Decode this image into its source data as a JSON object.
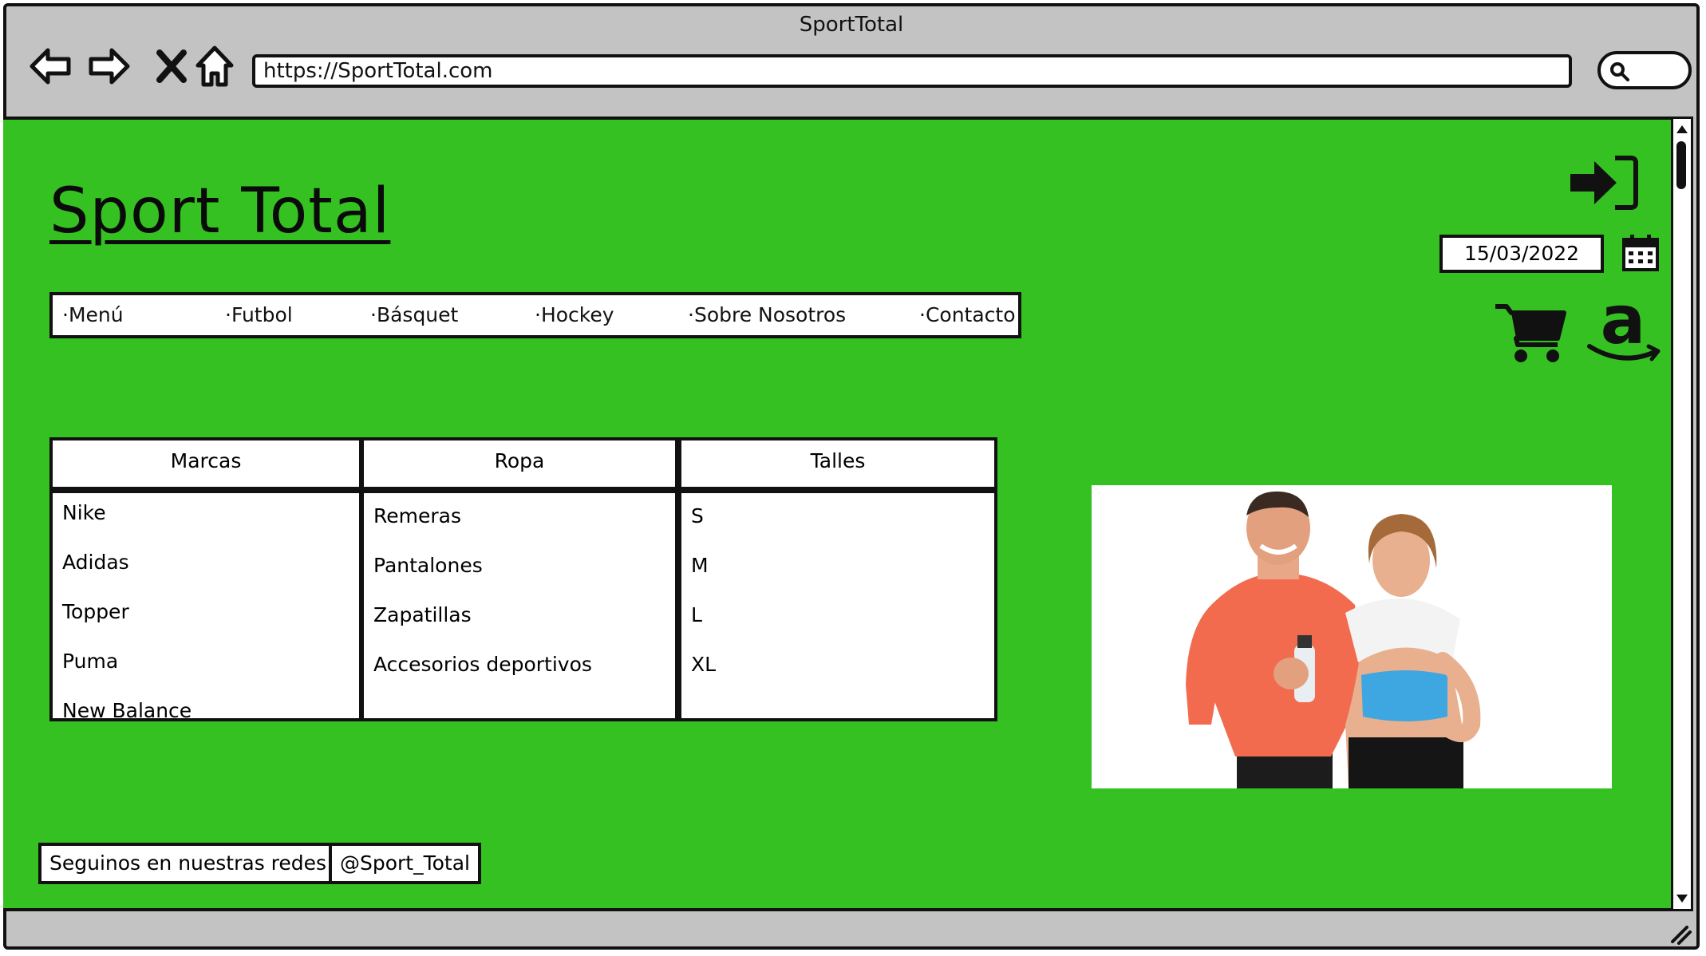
{
  "window": {
    "title": "SportTotal",
    "url": "https://SportTotal.com"
  },
  "icons": {
    "back": "back-arrow-icon",
    "forward": "forward-arrow-icon",
    "stop": "close-icon",
    "home": "home-icon",
    "search": "search-icon",
    "login": "sign-in-icon",
    "calendar": "calendar-icon",
    "cart": "shopping-cart-icon",
    "amazon": "amazon-logo-icon"
  },
  "colors": {
    "page_background": "#36c122",
    "chrome": "#c3c3c3"
  },
  "site": {
    "title": "Sport Total",
    "date": "15/03/2022"
  },
  "menu": {
    "items": [
      {
        "label": "·Menú"
      },
      {
        "label": "·Futbol"
      },
      {
        "label": "·Básquet"
      },
      {
        "label": "·Hockey"
      },
      {
        "label": "·Sobre Nosotros"
      },
      {
        "label": "·Contacto"
      }
    ]
  },
  "categories": {
    "marcas": {
      "header": "Marcas",
      "items": [
        "Nike",
        "Adidas",
        "Topper",
        "Puma",
        "New Balance"
      ]
    },
    "ropa": {
      "header": "Ropa",
      "items": [
        "Remeras",
        "Pantalones",
        "Zapatillas",
        "Accesorios deportivos"
      ]
    },
    "talles": {
      "header": "Talles",
      "items": [
        "S",
        "M",
        "L",
        "XL"
      ]
    }
  },
  "footer": {
    "social_label": "Seguinos en nuestras redes:",
    "social_handle": "@Sport_Total"
  }
}
